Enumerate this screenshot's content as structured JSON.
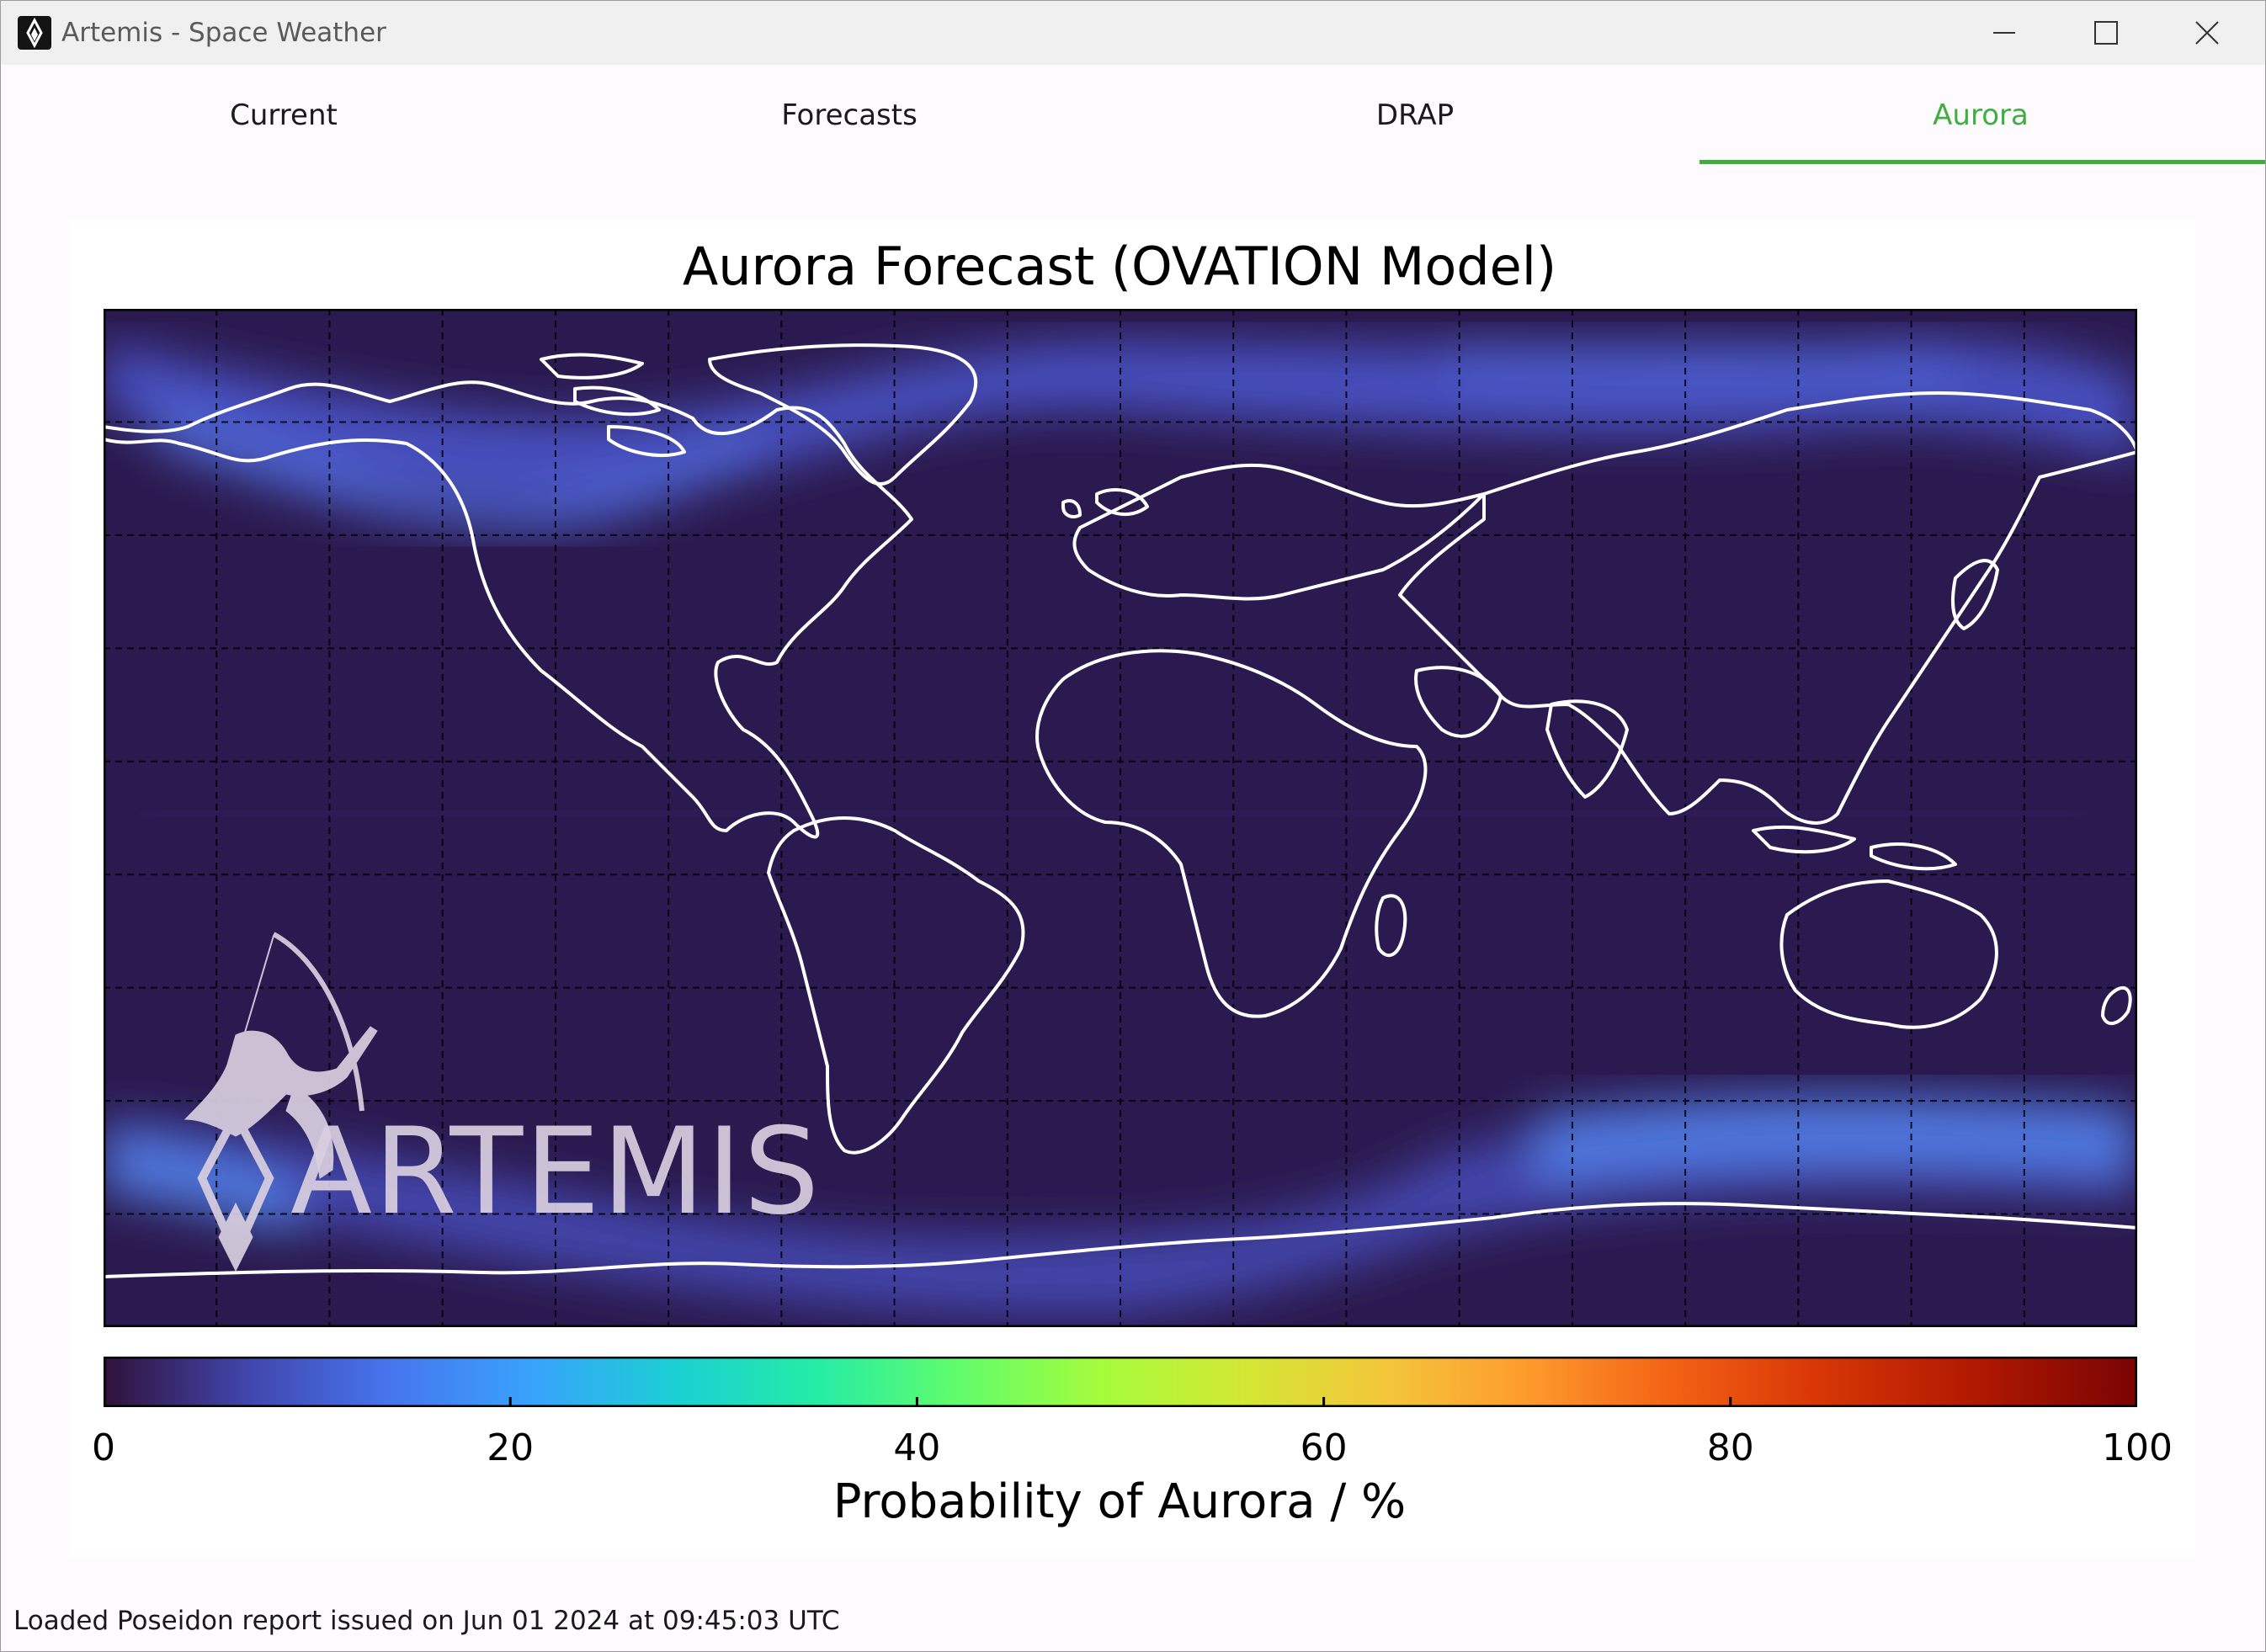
{
  "window": {
    "title": "Artemis - Space Weather"
  },
  "tabs": [
    {
      "label": "Current",
      "active": false
    },
    {
      "label": "Forecasts",
      "active": false
    },
    {
      "label": "DRAP",
      "active": false
    },
    {
      "label": "Aurora",
      "active": true
    }
  ],
  "colors": {
    "accent": "#3fae3f",
    "map_background": "#2b1a4f",
    "coastline": "#ffffff"
  },
  "plot": {
    "title": "Aurora Forecast (OVATION Model)",
    "watermark": "ARTEMIS"
  },
  "chart_data": {
    "type": "heatmap",
    "title": "Aurora Forecast (OVATION Model)",
    "projection": "equirectangular world map",
    "colormap": "turbo",
    "colorbar": {
      "label": "Probability of Aurora / %",
      "range": [
        0,
        100
      ],
      "ticks": [
        "0",
        "20",
        "40",
        "60",
        "80",
        "100"
      ]
    },
    "grid": true,
    "aurora_ovals": [
      {
        "region": "northern",
        "approx_max_probability": 15
      },
      {
        "region": "southern",
        "approx_max_probability": 15
      }
    ]
  },
  "status": {
    "text": "Loaded Poseidon report issued on Jun 01 2024 at 09:45:03 UTC"
  }
}
